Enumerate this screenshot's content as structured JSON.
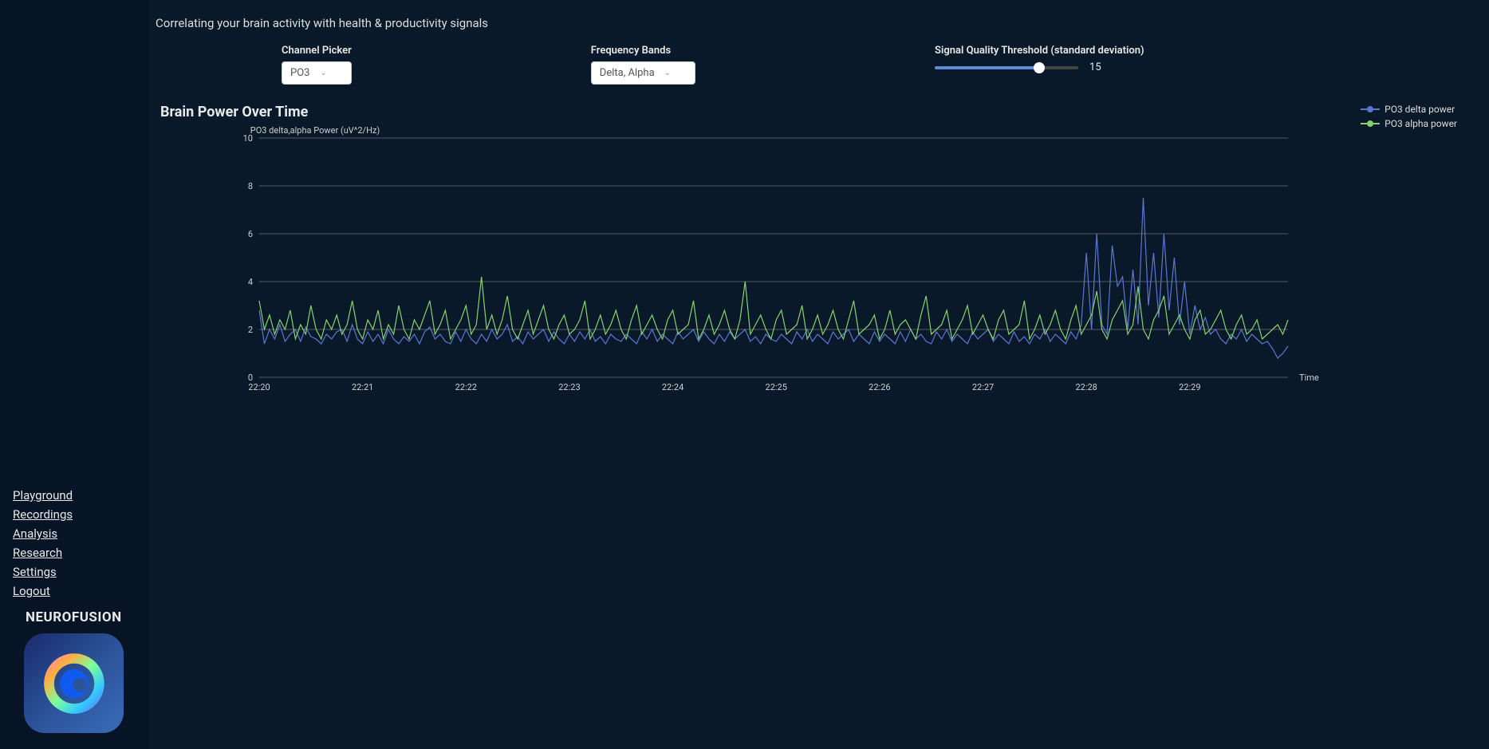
{
  "page": {
    "description": "Correlating your brain activity with health & productivity signals"
  },
  "sidebar": {
    "items": [
      {
        "label": "Playground"
      },
      {
        "label": "Recordings"
      },
      {
        "label": "Analysis"
      },
      {
        "label": "Research"
      },
      {
        "label": "Settings"
      },
      {
        "label": "Logout"
      }
    ],
    "brand": "NEUROFUSION"
  },
  "controls": {
    "channel_picker": {
      "label": "Channel Picker",
      "value": "PO3"
    },
    "frequency_bands": {
      "label": "Frequency Bands",
      "value": "Delta, Alpha"
    },
    "threshold": {
      "label": "Signal Quality Threshold (standard deviation)",
      "value": "15"
    }
  },
  "chart": {
    "title": "Brain Power Over Time"
  },
  "legend": {
    "s0": "PO3 delta power",
    "s1": "PO3 alpha power"
  },
  "chart_data": {
    "type": "line",
    "title": "Brain Power Over Time",
    "ylabel": "PO3 delta,alpha Power (uV^2/Hz)",
    "xlabel": "Time",
    "ylim": [
      0,
      10
    ],
    "yticks": [
      0,
      2,
      4,
      6,
      8,
      10
    ],
    "x_ticks": [
      "22:20",
      "22:21",
      "22:22",
      "22:23",
      "22:24",
      "22:25",
      "22:26",
      "22:27",
      "22:28",
      "22:29"
    ],
    "colors": {
      "PO3 delta power": "#5b76d1",
      "PO3 alpha power": "#86d36b"
    },
    "x": [
      0,
      0.05,
      0.1,
      0.15,
      0.2,
      0.25,
      0.3,
      0.35,
      0.4,
      0.45,
      0.5,
      0.55,
      0.6,
      0.65,
      0.7,
      0.75,
      0.8,
      0.85,
      0.9,
      0.95,
      1,
      1.05,
      1.1,
      1.15,
      1.2,
      1.25,
      1.3,
      1.35,
      1.4,
      1.45,
      1.5,
      1.55,
      1.6,
      1.65,
      1.7,
      1.75,
      1.8,
      1.85,
      1.9,
      1.95,
      2,
      2.05,
      2.1,
      2.15,
      2.2,
      2.25,
      2.3,
      2.35,
      2.4,
      2.45,
      2.5,
      2.55,
      2.6,
      2.65,
      2.7,
      2.75,
      2.8,
      2.85,
      2.9,
      2.95,
      3,
      3.05,
      3.1,
      3.15,
      3.2,
      3.25,
      3.3,
      3.35,
      3.4,
      3.45,
      3.5,
      3.55,
      3.6,
      3.65,
      3.7,
      3.75,
      3.8,
      3.85,
      3.9,
      3.95,
      4,
      4.05,
      4.1,
      4.15,
      4.2,
      4.25,
      4.3,
      4.35,
      4.4,
      4.45,
      4.5,
      4.55,
      4.6,
      4.65,
      4.7,
      4.75,
      4.8,
      4.85,
      4.9,
      4.95,
      5,
      5.05,
      5.1,
      5.15,
      5.2,
      5.25,
      5.3,
      5.35,
      5.4,
      5.45,
      5.5,
      5.55,
      5.6,
      5.65,
      5.7,
      5.75,
      5.8,
      5.85,
      5.9,
      5.95,
      6,
      6.05,
      6.1,
      6.15,
      6.2,
      6.25,
      6.3,
      6.35,
      6.4,
      6.45,
      6.5,
      6.55,
      6.6,
      6.65,
      6.7,
      6.75,
      6.8,
      6.85,
      6.9,
      6.95,
      7,
      7.05,
      7.1,
      7.15,
      7.2,
      7.25,
      7.3,
      7.35,
      7.4,
      7.45,
      7.5,
      7.55,
      7.6,
      7.65,
      7.7,
      7.75,
      7.8,
      7.85,
      7.9,
      7.95,
      8,
      8.05,
      8.1,
      8.15,
      8.2,
      8.25,
      8.3,
      8.35,
      8.4,
      8.45,
      8.5,
      8.55,
      8.6,
      8.65,
      8.7,
      8.75,
      8.8,
      8.85,
      8.9,
      8.95,
      9,
      9.05,
      9.1,
      9.15,
      9.2,
      9.25,
      9.3,
      9.35,
      9.4,
      9.45,
      9.5,
      9.55,
      9.6,
      9.65,
      9.7,
      9.75,
      9.8,
      9.85,
      9.9,
      9.95
    ],
    "series": [
      {
        "name": "PO3 delta power",
        "values": [
          2.8,
          1.4,
          2.0,
          1.6,
          2.2,
          1.5,
          1.8,
          2.0,
          1.5,
          2.1,
          1.7,
          1.6,
          1.4,
          1.8,
          1.6,
          1.9,
          2.0,
          1.5,
          2.2,
          1.6,
          1.4,
          1.9,
          1.5,
          1.8,
          1.4,
          2.0,
          1.6,
          1.4,
          1.7,
          1.5,
          1.8,
          1.4,
          1.9,
          2.1,
          1.6,
          1.8,
          1.5,
          1.4,
          1.9,
          1.5,
          2.0,
          1.6,
          1.4,
          1.8,
          1.5,
          2.0,
          1.6,
          1.8,
          2.2,
          1.5,
          1.7,
          1.4,
          1.9,
          1.6,
          1.8,
          2.0,
          1.5,
          1.9,
          1.6,
          1.4,
          1.8,
          1.5,
          1.9,
          1.6,
          2.0,
          1.5,
          1.7,
          1.4,
          1.8,
          1.6,
          1.5,
          1.8,
          1.6,
          1.4,
          1.9,
          1.6,
          2.0,
          1.5,
          1.8,
          1.6,
          1.4,
          1.9,
          1.6,
          1.8,
          2.0,
          1.5,
          1.9,
          1.6,
          1.4,
          1.8,
          1.5,
          1.9,
          1.6,
          1.8,
          2.0,
          1.5,
          1.7,
          1.4,
          1.8,
          1.6,
          1.5,
          1.8,
          1.6,
          1.4,
          1.9,
          1.6,
          2.0,
          1.5,
          1.8,
          1.6,
          1.4,
          1.9,
          1.6,
          1.8,
          2.0,
          1.5,
          1.8,
          1.6,
          1.4,
          1.9,
          1.5,
          1.8,
          1.6,
          1.4,
          1.9,
          1.5,
          2.0,
          1.6,
          1.8,
          1.5,
          1.4,
          1.9,
          1.6,
          2.0,
          1.5,
          1.8,
          1.6,
          1.4,
          1.9,
          1.6,
          1.8,
          2.0,
          1.5,
          1.8,
          1.6,
          1.4,
          1.9,
          1.5,
          1.7,
          1.4,
          1.8,
          1.6,
          2.0,
          1.5,
          1.8,
          1.6,
          1.4,
          1.9,
          1.6,
          2.2,
          5.2,
          2.0,
          6.0,
          2.2,
          1.8,
          5.5,
          3.8,
          4.2,
          2.0,
          4.5,
          2.2,
          7.5,
          3.0,
          5.2,
          2.5,
          6.0,
          2.8,
          5.0,
          2.2,
          4.0,
          1.8,
          3.0,
          2.0,
          2.5,
          1.8,
          2.0,
          1.6,
          1.4,
          1.8,
          1.6,
          2.0,
          1.5,
          1.8,
          1.6,
          1.4,
          1.5,
          1.2,
          0.8,
          1.0,
          1.3
        ]
      },
      {
        "name": "PO3 alpha power",
        "values": [
          3.2,
          2.0,
          2.6,
          1.8,
          2.4,
          2.0,
          2.8,
          1.6,
          2.2,
          1.8,
          3.0,
          2.0,
          1.6,
          2.4,
          2.0,
          2.6,
          1.8,
          2.2,
          3.2,
          2.0,
          1.6,
          2.4,
          2.0,
          2.8,
          1.6,
          2.2,
          1.8,
          3.0,
          2.0,
          1.6,
          2.4,
          2.0,
          2.6,
          3.2,
          1.8,
          2.2,
          2.8,
          1.6,
          2.0,
          2.4,
          3.0,
          1.8,
          2.2,
          4.2,
          2.0,
          2.6,
          1.8,
          2.4,
          3.4,
          2.0,
          1.6,
          2.2,
          2.8,
          1.8,
          2.4,
          3.0,
          2.0,
          1.6,
          2.2,
          2.6,
          1.8,
          2.0,
          2.4,
          3.2,
          1.6,
          2.0,
          2.6,
          1.8,
          2.2,
          2.8,
          2.0,
          1.6,
          2.4,
          3.0,
          1.8,
          2.2,
          2.6,
          2.0,
          1.6,
          2.4,
          2.8,
          1.8,
          2.0,
          2.2,
          3.2,
          1.6,
          2.0,
          2.6,
          1.8,
          2.2,
          2.8,
          2.0,
          1.6,
          2.4,
          4.0,
          1.8,
          2.2,
          2.6,
          2.0,
          1.6,
          2.4,
          2.8,
          1.8,
          2.0,
          2.2,
          3.0,
          1.6,
          2.0,
          2.6,
          1.8,
          2.2,
          2.8,
          2.0,
          1.6,
          2.4,
          3.2,
          1.8,
          2.0,
          2.2,
          2.6,
          1.6,
          2.0,
          2.8,
          1.8,
          2.2,
          2.4,
          2.0,
          1.6,
          2.6,
          3.4,
          1.8,
          2.0,
          2.2,
          2.8,
          1.6,
          2.0,
          2.4,
          3.0,
          1.8,
          2.2,
          2.6,
          2.0,
          1.6,
          2.4,
          2.8,
          1.8,
          2.0,
          2.2,
          3.2,
          1.6,
          2.0,
          2.6,
          1.8,
          2.2,
          2.8,
          2.0,
          1.6,
          2.4,
          3.0,
          1.8,
          2.2,
          2.6,
          3.6,
          2.0,
          1.6,
          2.4,
          2.8,
          3.2,
          1.8,
          2.2,
          3.8,
          2.0,
          1.6,
          2.4,
          2.8,
          3.4,
          1.8,
          2.2,
          2.6,
          2.0,
          1.6,
          2.4,
          2.8,
          1.8,
          2.0,
          2.4,
          2.8,
          2.0,
          1.6,
          2.2,
          2.6,
          1.8,
          2.0,
          2.4,
          1.6,
          1.8,
          2.0,
          2.2,
          1.8,
          2.4
        ]
      }
    ]
  }
}
